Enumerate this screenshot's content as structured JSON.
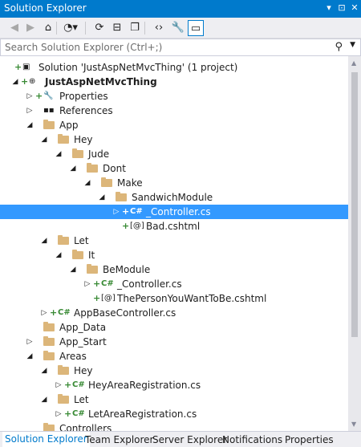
{
  "window": {
    "title": "Solution Explorer",
    "title_buttons": [
      "▾",
      "⊡",
      "✕"
    ]
  },
  "toolbar": {
    "tools": [
      {
        "name": "back-icon",
        "glyph": "◀",
        "disabled": true
      },
      {
        "name": "forward-icon",
        "glyph": "▶",
        "disabled": true
      },
      {
        "name": "home-icon",
        "glyph": "⌂",
        "disabled": false
      },
      {
        "name": "history-icon",
        "glyph": "◔▾",
        "disabled": false
      },
      {
        "name": "sync-icon",
        "glyph": "⟳",
        "disabled": false
      },
      {
        "name": "collapse-all-icon",
        "glyph": "⊟",
        "disabled": false
      },
      {
        "name": "show-all-files-icon",
        "glyph": "❐",
        "disabled": false
      },
      {
        "name": "view-code-icon",
        "glyph": "‹›",
        "disabled": false
      },
      {
        "name": "properties-icon",
        "glyph": "🔧",
        "disabled": false
      },
      {
        "name": "preview-icon",
        "glyph": "▭",
        "disabled": false
      }
    ]
  },
  "search": {
    "placeholder": "Search Solution Explorer (Ctrl+;)"
  },
  "tree": [
    {
      "label": "Solution 'JustAspNetMvcThing' (1 project)",
      "kind": "solution",
      "level": 0,
      "expander": "",
      "prefix": "+"
    },
    {
      "label": "JustAspNetMvcThing",
      "kind": "project",
      "level": 0,
      "expander": "◢",
      "prefix": "+",
      "bold": true
    },
    {
      "label": "Properties",
      "kind": "properties",
      "level": 1,
      "expander": "▷",
      "prefix": "+"
    },
    {
      "label": "References",
      "kind": "references",
      "level": 1,
      "expander": "▷",
      "prefix": ""
    },
    {
      "label": "App",
      "kind": "folder",
      "level": 1,
      "expander": "◢",
      "prefix": ""
    },
    {
      "label": "Hey",
      "kind": "folder",
      "level": 2,
      "expander": "◢",
      "prefix": ""
    },
    {
      "label": "Jude",
      "kind": "folder",
      "level": 3,
      "expander": "◢",
      "prefix": ""
    },
    {
      "label": "Dont",
      "kind": "folder",
      "level": 4,
      "expander": "◢",
      "prefix": ""
    },
    {
      "label": "Make",
      "kind": "folder",
      "level": 5,
      "expander": "◢",
      "prefix": ""
    },
    {
      "label": "SandwichModule",
      "kind": "folder",
      "level": 6,
      "expander": "◢",
      "prefix": ""
    },
    {
      "label": "_Controller.cs",
      "kind": "cs",
      "level": 7,
      "expander": "▷",
      "prefix": "+",
      "selected": true
    },
    {
      "label": "Bad.cshtml",
      "kind": "razor",
      "level": 7,
      "expander": "",
      "prefix": "+"
    },
    {
      "label": "Let",
      "kind": "folder",
      "level": 2,
      "expander": "◢",
      "prefix": ""
    },
    {
      "label": "It",
      "kind": "folder",
      "level": 3,
      "expander": "◢",
      "prefix": ""
    },
    {
      "label": "BeModule",
      "kind": "folder",
      "level": 4,
      "expander": "◢",
      "prefix": ""
    },
    {
      "label": "_Controller.cs",
      "kind": "cs",
      "level": 5,
      "expander": "▷",
      "prefix": "+"
    },
    {
      "label": "ThePersonYouWantToBe.cshtml",
      "kind": "razor",
      "level": 5,
      "expander": "",
      "prefix": "+"
    },
    {
      "label": "AppBaseController.cs",
      "kind": "cs",
      "level": 2,
      "expander": "▷",
      "prefix": "+"
    },
    {
      "label": "App_Data",
      "kind": "folder",
      "level": 1,
      "expander": "",
      "prefix": ""
    },
    {
      "label": "App_Start",
      "kind": "folder",
      "level": 1,
      "expander": "▷",
      "prefix": ""
    },
    {
      "label": "Areas",
      "kind": "folder",
      "level": 1,
      "expander": "◢",
      "prefix": ""
    },
    {
      "label": "Hey",
      "kind": "folder",
      "level": 2,
      "expander": "◢",
      "prefix": ""
    },
    {
      "label": "HeyAreaRegistration.cs",
      "kind": "cs",
      "level": 3,
      "expander": "▷",
      "prefix": "+"
    },
    {
      "label": "Let",
      "kind": "folder",
      "level": 2,
      "expander": "◢",
      "prefix": ""
    },
    {
      "label": "LetAreaRegistration.cs",
      "kind": "cs",
      "level": 3,
      "expander": "▷",
      "prefix": "+"
    },
    {
      "label": "Controllers",
      "kind": "folder",
      "level": 1,
      "expander": "",
      "prefix": ""
    }
  ],
  "tabs": [
    {
      "label": "Solution Explorer",
      "active": true
    },
    {
      "label": "Team Explorer",
      "active": false
    },
    {
      "label": "Server Explorer",
      "active": false
    },
    {
      "label": "Notifications",
      "active": false
    },
    {
      "label": "Properties",
      "active": false
    }
  ],
  "colors": {
    "accent": "#007acc",
    "selection": "#3399ff",
    "folder": "#dcb67a",
    "added_green": "#388a34"
  }
}
